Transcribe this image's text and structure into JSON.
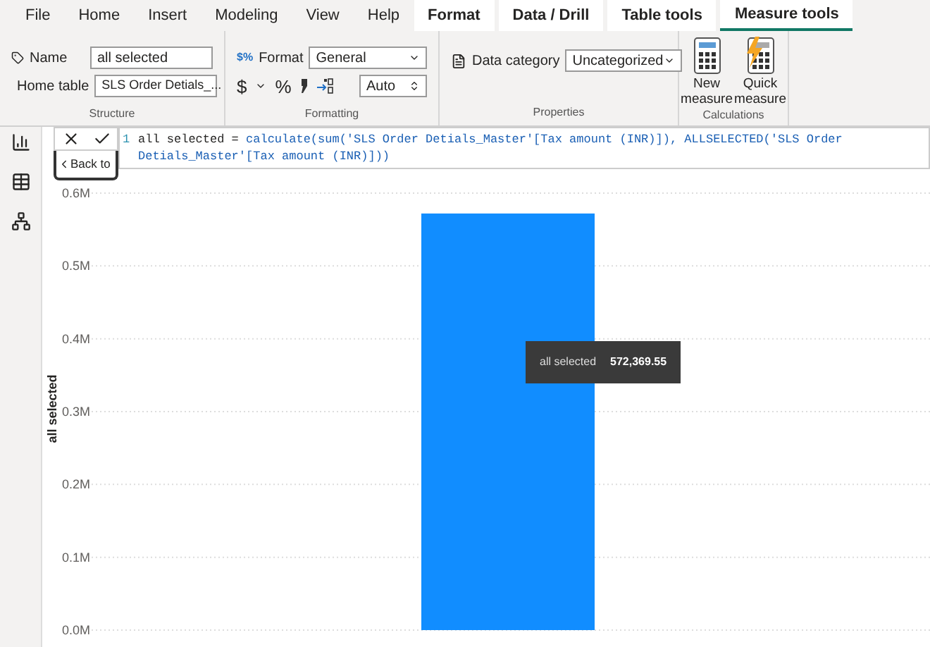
{
  "tabs": [
    {
      "label": "File",
      "selected": false,
      "contextual": false
    },
    {
      "label": "Home",
      "selected": false,
      "contextual": false
    },
    {
      "label": "Insert",
      "selected": false,
      "contextual": false
    },
    {
      "label": "Modeling",
      "selected": false,
      "contextual": false
    },
    {
      "label": "View",
      "selected": false,
      "contextual": false
    },
    {
      "label": "Help",
      "selected": false,
      "contextual": false
    },
    {
      "label": "Format",
      "selected": false,
      "contextual": true
    },
    {
      "label": "Data / Drill",
      "selected": false,
      "contextual": true
    },
    {
      "label": "Table tools",
      "selected": false,
      "contextual": true
    },
    {
      "label": "Measure tools",
      "selected": true,
      "contextual": true
    }
  ],
  "structure": {
    "name_label": "Name",
    "name_value": "all selected",
    "home_table_label": "Home table",
    "home_table_value": "SLS Order Detials_...",
    "group": "Structure"
  },
  "formatting": {
    "format_icon": "$%",
    "format_label": "Format",
    "format_value": "General",
    "currency": "$",
    "percent": "%",
    "decimals": "Auto",
    "group": "Formatting"
  },
  "properties": {
    "data_category_label": "Data category",
    "data_category_value": "Uncategorized",
    "group": "Properties"
  },
  "calculations": {
    "buttons": [
      {
        "label": "New measure",
        "kind": "new"
      },
      {
        "label": "Quick measure",
        "kind": "quick"
      }
    ],
    "group": "Calculations"
  },
  "formula": {
    "line_number": "1",
    "text_before": "all selected = ",
    "code": "calculate(sum('SLS Order Detials_Master'[Tax amount (INR)]), ALLSELECTED('SLS Order Detials_Master'[Tax amount (INR)]))"
  },
  "back_button": "Back to",
  "chart": {
    "chart_data": {
      "type": "bar",
      "ylabel": "all selected",
      "values": [
        572000
      ],
      "grid": true,
      "ylim": [
        0,
        600000
      ],
      "yticks": [
        {
          "value": 0,
          "label": "0.0M"
        },
        {
          "value": 100000,
          "label": "0.1M"
        },
        {
          "value": 200000,
          "label": "0.2M"
        },
        {
          "value": 300000,
          "label": "0.3M"
        },
        {
          "value": 400000,
          "label": "0.4M"
        },
        {
          "value": 500000,
          "label": "0.5M"
        },
        {
          "value": 600000,
          "label": "0.6M"
        }
      ]
    }
  },
  "tooltip": {
    "label": "all selected",
    "value": "572,369.55"
  }
}
